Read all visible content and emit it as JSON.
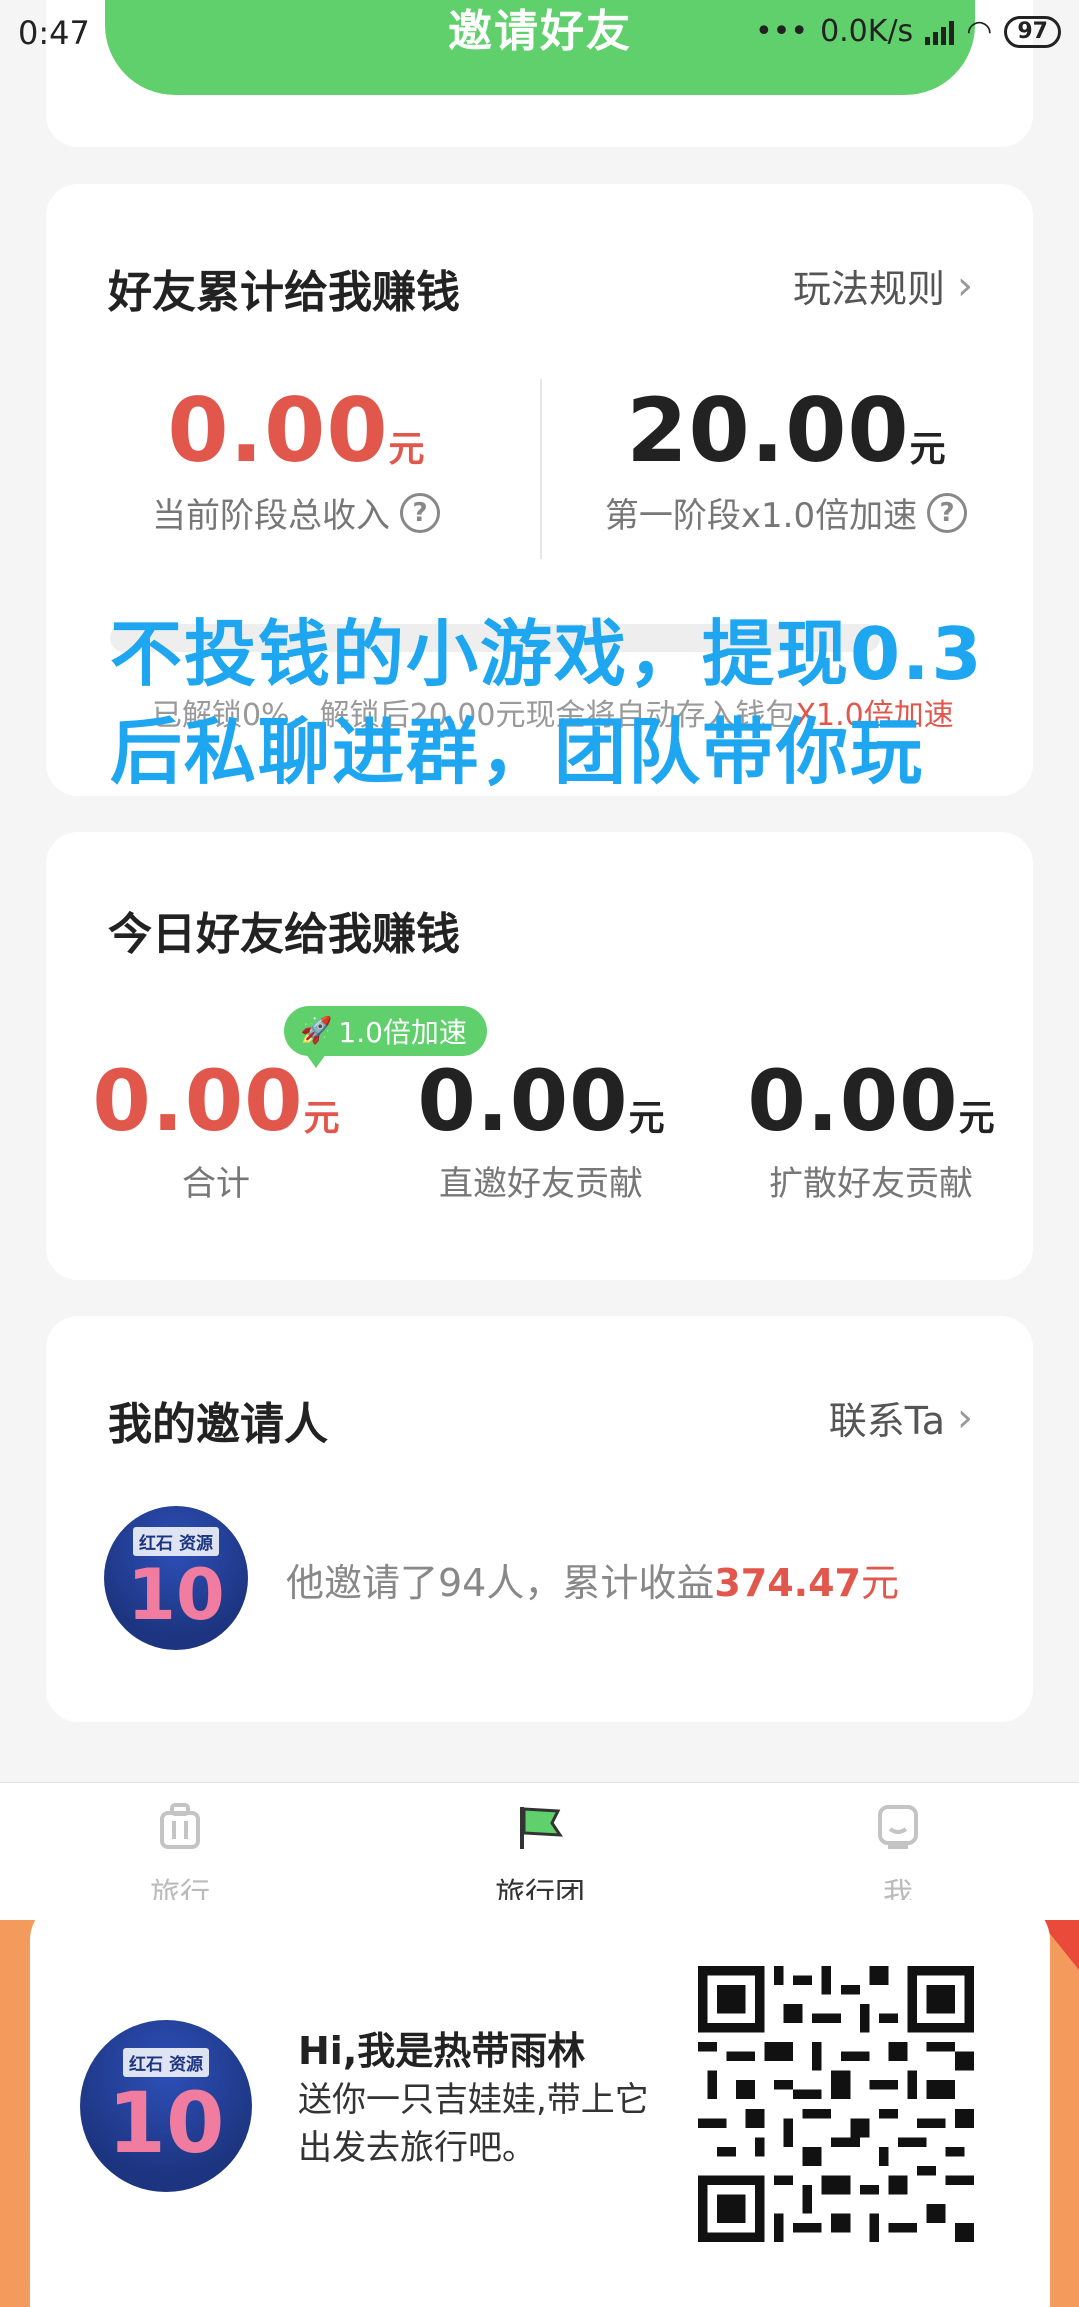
{
  "status_bar": {
    "time": "0:47",
    "net_speed": "0.0K/s",
    "battery": "97"
  },
  "header": {
    "invite_button": "邀请好友"
  },
  "earnings_card": {
    "title": "好友累计给我赚钱",
    "rules_link": "玩法规则",
    "current_income": {
      "value": "0.00",
      "unit": "元",
      "label": "当前阶段总收入"
    },
    "stage_target": {
      "value": "20.00",
      "unit": "元",
      "label": "第一阶段x1.0倍加速"
    },
    "progress_percent": 0,
    "unlock_text_prefix": "已解锁0%，解锁后20.00元现金将自动存入钱包",
    "unlock_text_accent": "X1.0倍加速"
  },
  "overlay_text": "不投钱的小游戏，提现0.3后私聊进群，团队带你玩",
  "today_card": {
    "title": "今日好友给我赚钱",
    "badge": "1.0倍加速",
    "stats": [
      {
        "value": "0.00",
        "unit": "元",
        "label": "合计"
      },
      {
        "value": "0.00",
        "unit": "元",
        "label": "直邀好友贡献"
      },
      {
        "value": "0.00",
        "unit": "元",
        "label": "扩散好友贡献"
      }
    ]
  },
  "inviter_card": {
    "title": "我的邀请人",
    "contact_link": "联系Ta",
    "info_prefix": "他邀请了94人，累计收益",
    "info_amount": "374.47",
    "info_unit": "元",
    "avatar_text_top": "红石 资源",
    "avatar_number": "10"
  },
  "tabbar": {
    "tabs": [
      {
        "label": "旅行",
        "icon": "luggage-icon"
      },
      {
        "label": "旅行团",
        "icon": "flag-icon"
      },
      {
        "label": "我",
        "icon": "profile-icon"
      }
    ],
    "active": "旅行团"
  },
  "share_card": {
    "title": "Hi,我是热带雨林",
    "subtitle": "送你一只吉娃娃,带上它出发去旅行吧。",
    "avatar_text_top": "红石 资源",
    "avatar_number": "10"
  },
  "colors": {
    "green": "#5fd06b",
    "red": "#e2574c",
    "overlay_blue": "#1ea7f0",
    "orange": "#f39a5c"
  }
}
